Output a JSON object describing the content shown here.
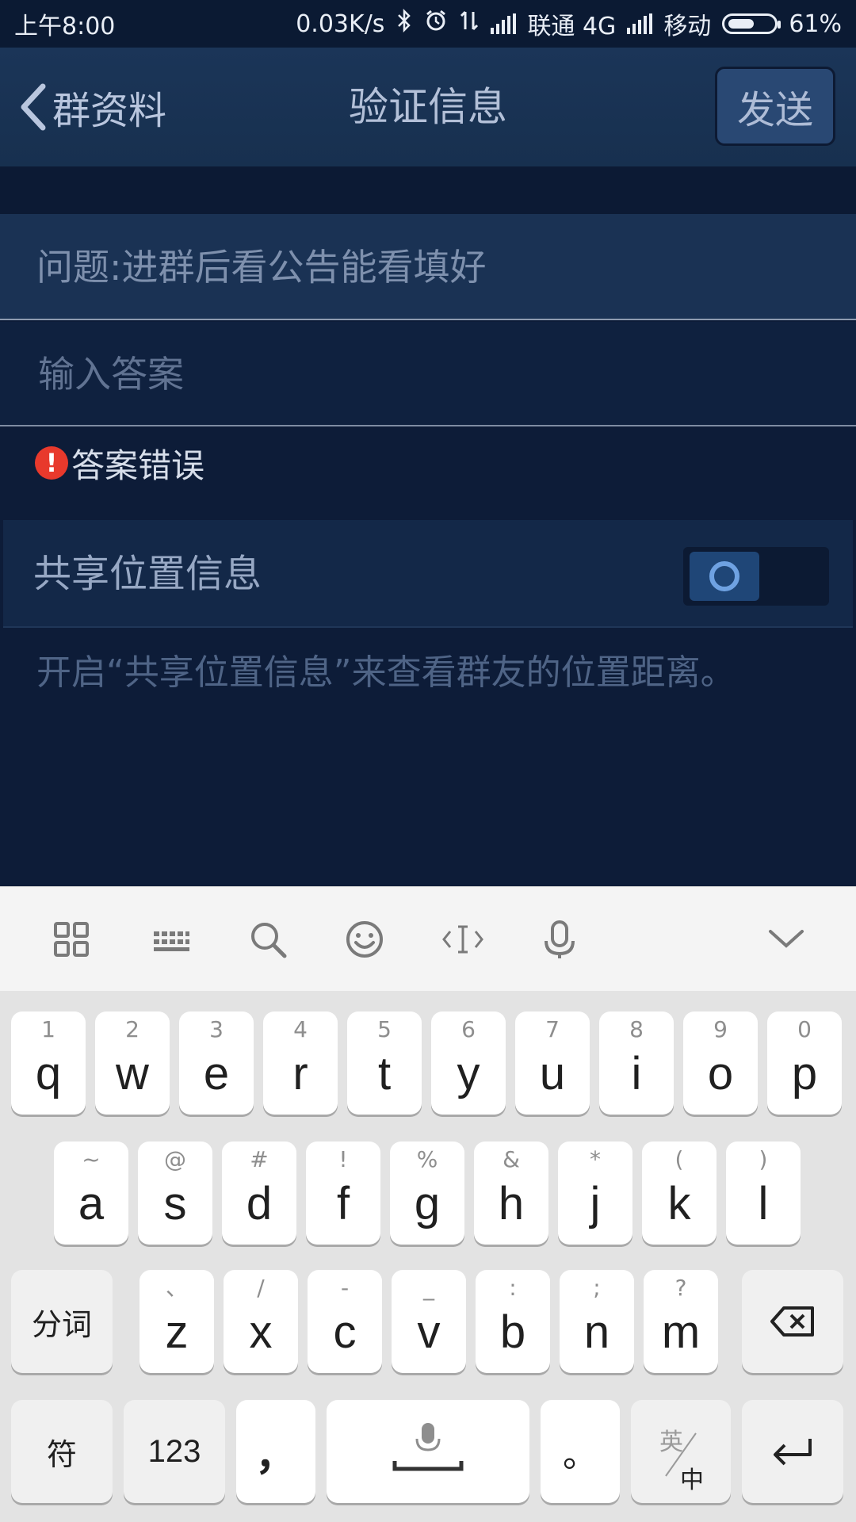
{
  "status_bar": {
    "time": "上午8:00",
    "net_speed": "0.03K/s",
    "carrier1": "联通 4G",
    "carrier2": "移动",
    "battery_level": 0.61,
    "battery": "61%"
  },
  "header": {
    "back_label": "群资料",
    "title": "验证信息",
    "send_label": "发送"
  },
  "form": {
    "question": "问题:进群后看公告能看填好",
    "answer_placeholder": "输入答案",
    "answer_value": "",
    "error_text": "答案错误",
    "share_label": "共享位置信息",
    "share_enabled": false,
    "hint": "开启“共享位置信息”来查看群友的位置距离。"
  },
  "keyboard": {
    "toolbar": [
      "grid-icon",
      "keyboard-icon",
      "search-icon",
      "emoji-icon",
      "cursor-icon",
      "microphone-icon",
      "collapse-chevron-icon"
    ],
    "row1": [
      {
        "main": "q",
        "sub": "1"
      },
      {
        "main": "w",
        "sub": "2"
      },
      {
        "main": "e",
        "sub": "3"
      },
      {
        "main": "r",
        "sub": "4"
      },
      {
        "main": "t",
        "sub": "5"
      },
      {
        "main": "y",
        "sub": "6"
      },
      {
        "main": "u",
        "sub": "7"
      },
      {
        "main": "i",
        "sub": "8"
      },
      {
        "main": "o",
        "sub": "9"
      },
      {
        "main": "p",
        "sub": "0"
      }
    ],
    "row2": [
      {
        "main": "a",
        "sub": "~"
      },
      {
        "main": "s",
        "sub": "@"
      },
      {
        "main": "d",
        "sub": "#"
      },
      {
        "main": "f",
        "sub": "!"
      },
      {
        "main": "g",
        "sub": "%"
      },
      {
        "main": "h",
        "sub": "&"
      },
      {
        "main": "j",
        "sub": "*"
      },
      {
        "main": "k",
        "sub": "("
      },
      {
        "main": "l",
        "sub": ")"
      }
    ],
    "row3": [
      {
        "main": "z",
        "sub": "、"
      },
      {
        "main": "x",
        "sub": "/"
      },
      {
        "main": "c",
        "sub": "-"
      },
      {
        "main": "v",
        "sub": "_"
      },
      {
        "main": "b",
        "sub": ":"
      },
      {
        "main": "n",
        "sub": ";"
      },
      {
        "main": "m",
        "sub": "?"
      }
    ],
    "segment_key": "分词",
    "symbol_key": "符",
    "num_key": "123",
    "comma_key": "，",
    "period_key": "。",
    "lang_top": "英",
    "lang_bottom": "中"
  }
}
